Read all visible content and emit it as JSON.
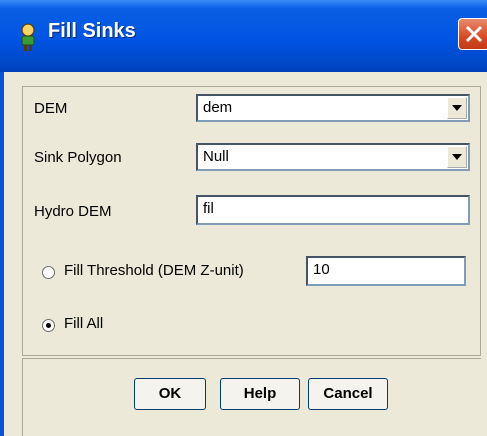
{
  "title": "Fill Sinks",
  "fields": {
    "dem_label": "DEM",
    "dem_value": "dem",
    "sink_label": "Sink Polygon",
    "sink_value": "Null",
    "hydro_label": "Hydro DEM",
    "hydro_value": "fil",
    "threshold_label": "Fill Threshold (DEM Z-unit)",
    "threshold_value": "10",
    "fill_all_label": "Fill All"
  },
  "selected_option": "Fill All",
  "buttons": {
    "ok": "OK",
    "help": "Help",
    "cancel": "Cancel"
  },
  "colors": {
    "titlebar": "#0054E3",
    "close_button": "#D54A24",
    "window_bg": "#ECE9D8"
  }
}
